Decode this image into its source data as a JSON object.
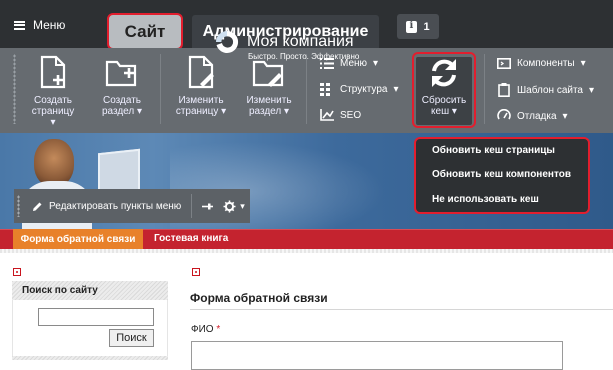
{
  "topbar": {
    "menu_label": "Меню",
    "tab_site": "Сайт",
    "tab_admin": "Администрирование",
    "notifications_count": "1"
  },
  "toolbar": {
    "create_page": [
      "Создать",
      "страницу"
    ],
    "create_section": [
      "Создать",
      "раздел"
    ],
    "edit_page": [
      "Изменить",
      "страницу"
    ],
    "edit_section": [
      "Изменить",
      "раздел"
    ],
    "menu": "Меню",
    "structure": "Структура",
    "seo": "SEO",
    "reset_cache": [
      "Сбросить",
      "кеш"
    ],
    "components": "Компоненты",
    "site_template": "Шаблон сайта",
    "debug": "Отладка"
  },
  "cache_dropdown": {
    "items": [
      "Обновить кеш страницы",
      "Обновить кеш компонентов",
      "Не использовать кеш"
    ]
  },
  "banner": {
    "company": "Моя компания",
    "slogan": "Быстро. Просто. Эффективно"
  },
  "edit_panel": {
    "label": "Редактировать пункты меню"
  },
  "nav": {
    "items": [
      "Форма обратной связи",
      "Гостевая книга"
    ]
  },
  "sidebar": {
    "title": "Поиск по сайту",
    "search_value": "",
    "search_button": "Поиск"
  },
  "form": {
    "title": "Форма обратной связи",
    "fio_label": "ФИО",
    "required_mark": "*",
    "fio_value": ""
  },
  "colors": {
    "highlight": "#e21e2e",
    "topbar": "#2d3033",
    "toolbar": "#666b70",
    "nav_bar": "#c4232f",
    "nav_active": "#e8812a"
  }
}
